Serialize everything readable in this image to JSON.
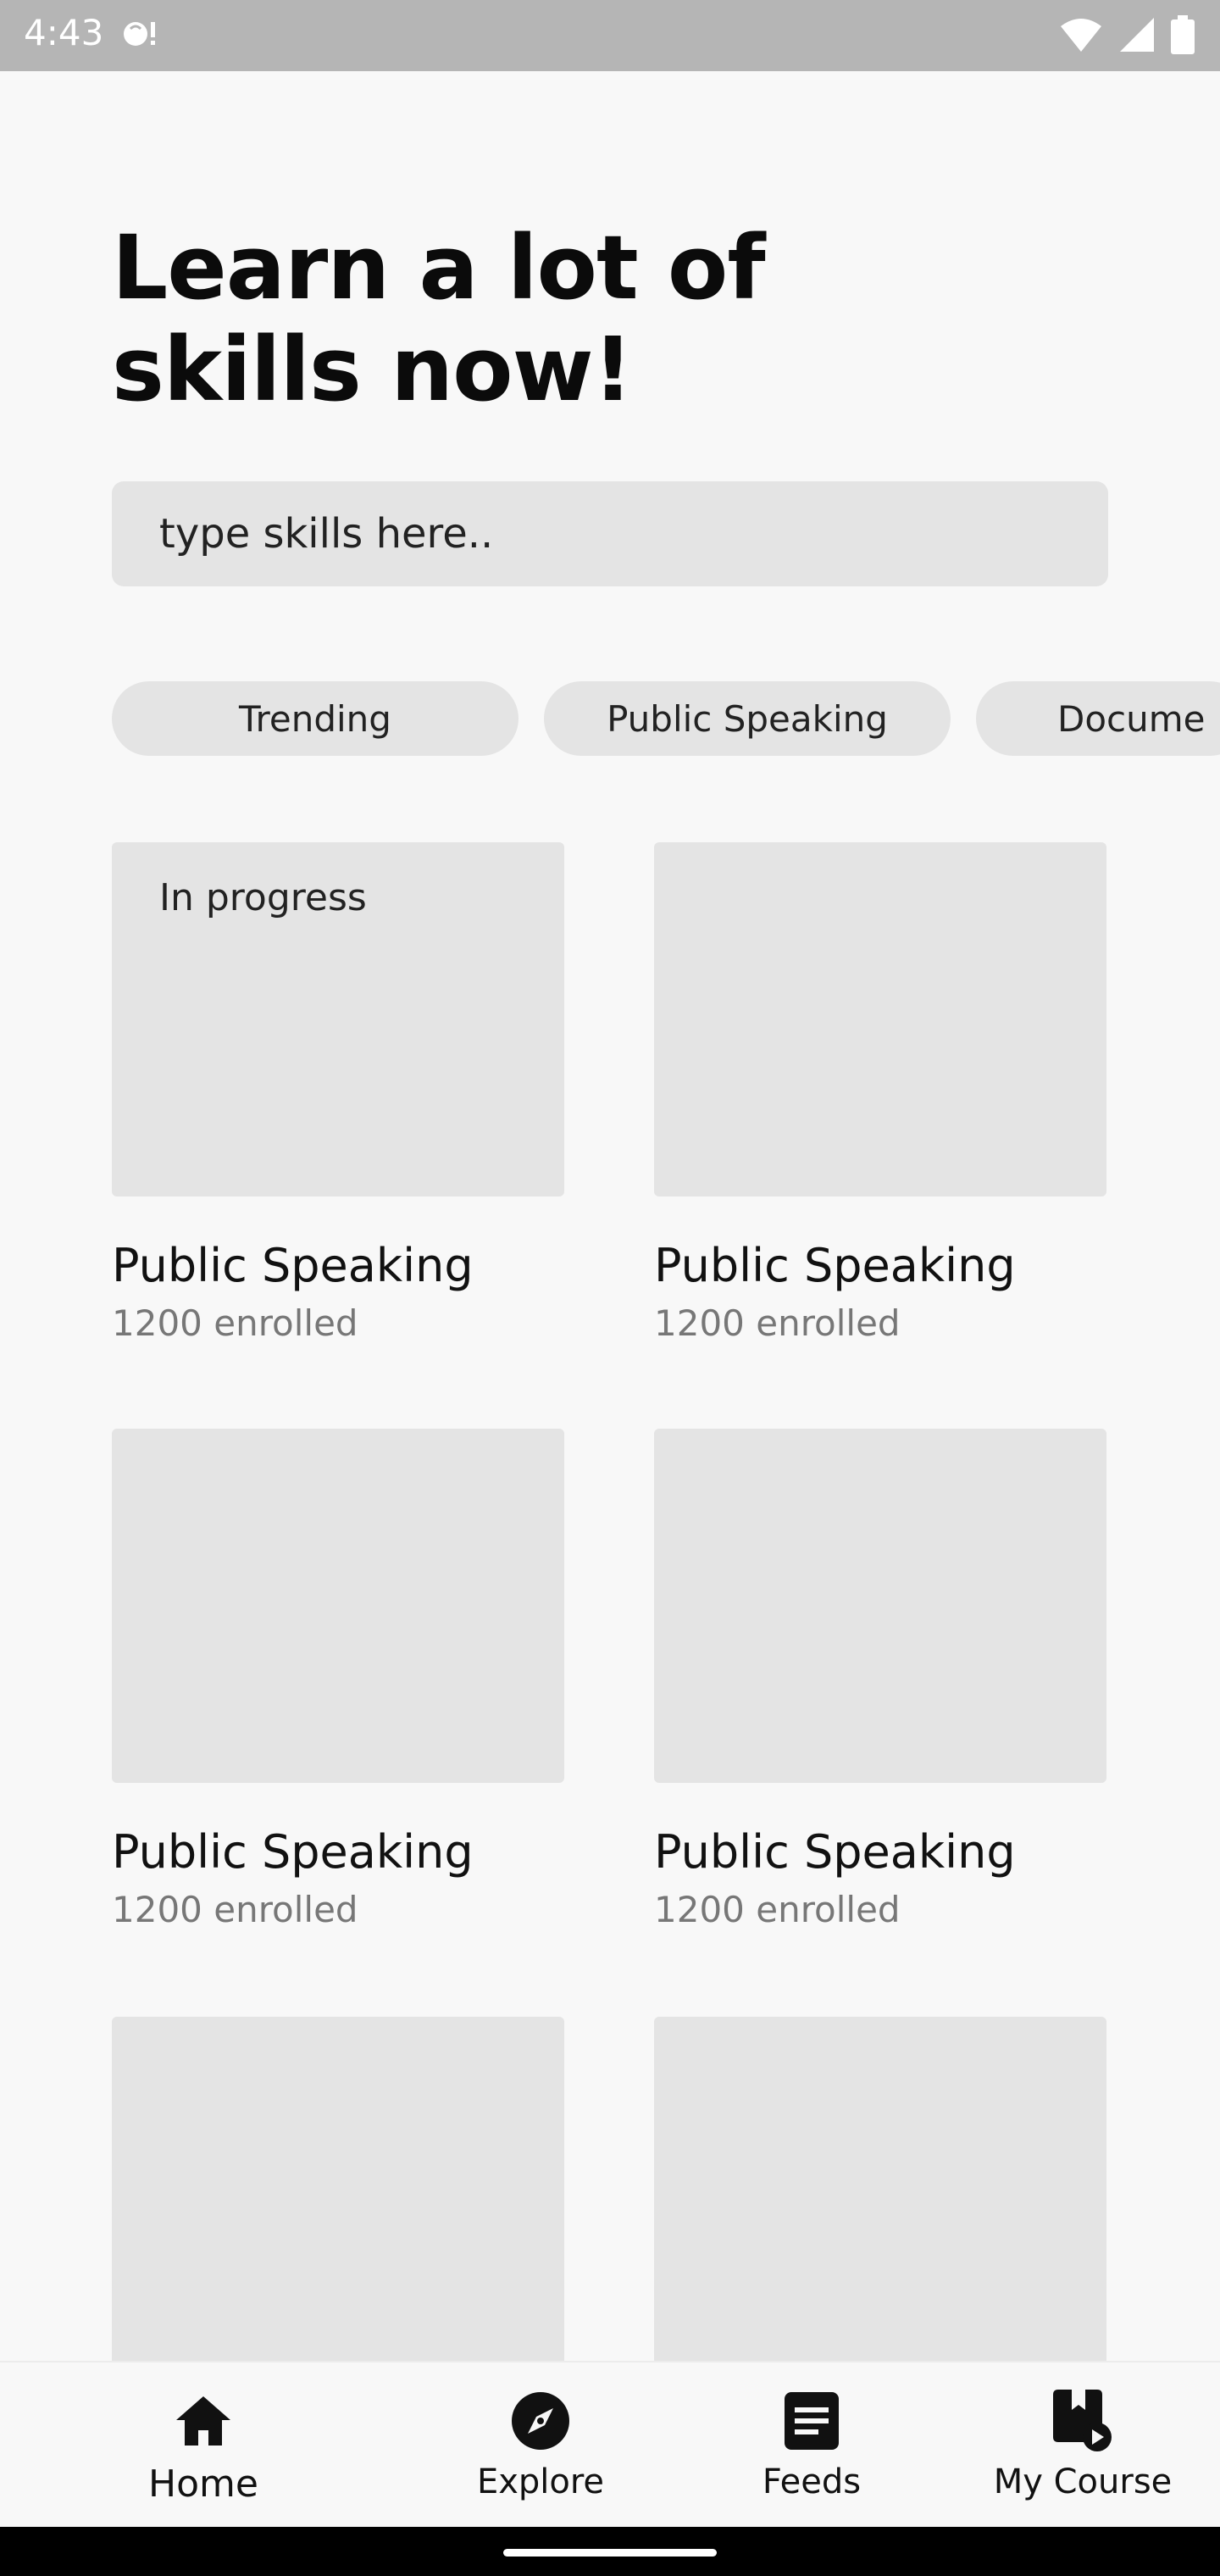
{
  "status_bar": {
    "time": "4:43"
  },
  "headline": "Learn a lot of\nskills now!",
  "search": {
    "placeholder": "type skills here..",
    "value": ""
  },
  "chips": [
    "Trending",
    "Public Speaking",
    "Docume"
  ],
  "courses": [
    {
      "badge": "In progress",
      "title": "Public Speaking",
      "enrolled": "1200 enrolled"
    },
    {
      "badge": "",
      "title": "Public Speaking",
      "enrolled": "1200 enrolled"
    },
    {
      "badge": "",
      "title": "Public Speaking",
      "enrolled": "1200 enrolled"
    },
    {
      "badge": "",
      "title": "Public Speaking",
      "enrolled": "1200 enrolled"
    },
    {
      "badge": "",
      "title": "",
      "enrolled": ""
    },
    {
      "badge": "",
      "title": "",
      "enrolled": ""
    }
  ],
  "bottom_nav": {
    "items": [
      {
        "label": "Home",
        "icon": "home-icon",
        "active": true
      },
      {
        "label": "Explore",
        "icon": "compass-icon",
        "active": false
      },
      {
        "label": "Feeds",
        "icon": "document-icon",
        "active": false
      },
      {
        "label": "My Course",
        "icon": "bookmark-play-icon",
        "active": false
      }
    ]
  },
  "colors": {
    "background": "#f8f8f8",
    "placeholder_fill": "#e4e4e4",
    "status_bar": "#b5b5b5"
  }
}
